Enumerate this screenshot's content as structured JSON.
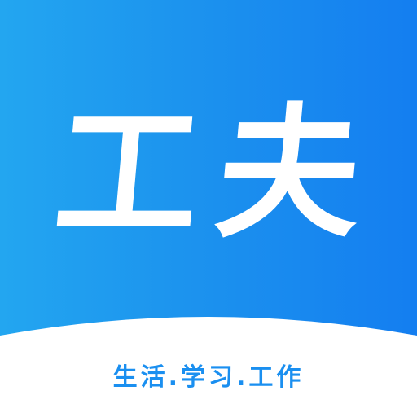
{
  "logo": {
    "title": "工夫",
    "tagline": "生活.学习.工作"
  },
  "colors": {
    "background_start": "#23a6f0",
    "background_end": "#147ef0",
    "band": "#ffffff",
    "title_text": "#ffffff",
    "tagline_text": "#1a8ff0"
  }
}
